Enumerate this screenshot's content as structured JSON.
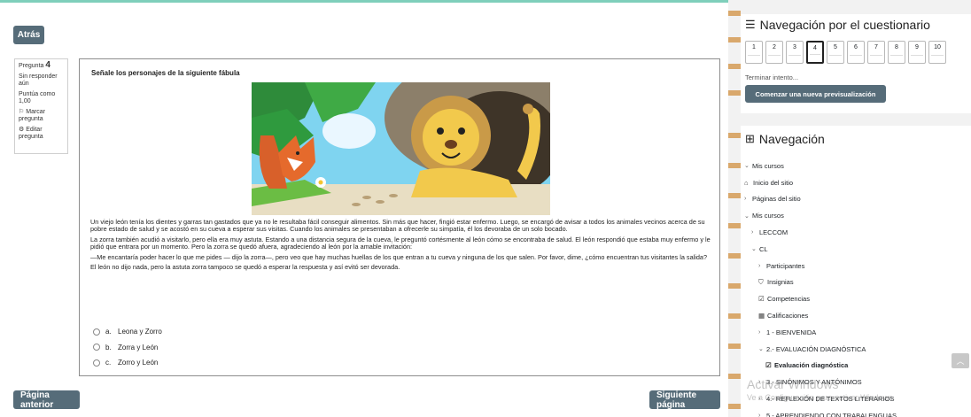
{
  "buttons": {
    "back": "Atrás",
    "prev_page": "Página anterior",
    "next_page": "Siguiente página"
  },
  "question_info": {
    "label": "Pregunta",
    "number": "4",
    "status": "Sin responder aún",
    "points": "Puntúa como 1,00",
    "flag": "Marcar pregunta",
    "edit": "Editar pregunta"
  },
  "question": {
    "title": "Señale los personajes de la siguiente fábula",
    "paragraphs": [
      "Un viejo león tenía los dientes y garras tan gastados que ya no le resultaba fácil conseguir alimentos. Sin más que hacer, fingió estar enfermo. Luego, se encargó de avisar a todos los animales vecinos acerca de su pobre estado de salud y se acostó en su cueva a esperar sus visitas. Cuando los animales se presentaban a ofrecerle su simpatía, él los devoraba de un solo bocado.",
      "La zorra también acudió a visitarlo, pero ella era muy astuta. Estando a una distancia segura de la cueva, le preguntó cortésmente al león cómo se encontraba de salud. El león respondió que estaba muy enfermo y le pidió que entrara por un momento. Pero la zorra se quedó afuera, agradeciendo al león por la amable invitación:",
      "—Me encantaría poder hacer lo que me pides — dijo la zorra—, pero veo que hay muchas huellas de los que entran a tu cueva y ninguna de los que salen. Por favor, dime, ¿cómo encuentran tus visitantes la salida?",
      "El león no dijo nada, pero la astuta zorra tampoco se quedó a esperar la respuesta y así evitó ser devorada."
    ],
    "options": [
      {
        "letter": "a.",
        "text": "Leona y Zorro"
      },
      {
        "letter": "b.",
        "text": "Zorra y León"
      },
      {
        "letter": "c.",
        "text": "Zorro y León"
      }
    ]
  },
  "quiz_nav": {
    "title": "Navegación por el cuestionario",
    "questions": [
      "1",
      "2",
      "3",
      "4",
      "5",
      "6",
      "7",
      "8",
      "9",
      "10"
    ],
    "current": "4",
    "finish_link": "Terminar intento...",
    "new_preview": "Comenzar una nueva previsualización"
  },
  "navigation": {
    "title": "Navegación",
    "items": [
      {
        "label": "Mis cursos",
        "chev": "⌄",
        "icon": ""
      },
      {
        "label": "Inicio del sitio",
        "chev": "",
        "icon": "⌂"
      },
      {
        "label": "Páginas del sitio",
        "chev": "›",
        "icon": ""
      },
      {
        "label": "Mis cursos",
        "chev": "⌄",
        "icon": ""
      },
      {
        "label": "LECCOM",
        "chev": "›",
        "icon": ""
      },
      {
        "label": "CL",
        "chev": "⌄",
        "icon": ""
      },
      {
        "label": "Participantes",
        "chev": "›",
        "icon": ""
      },
      {
        "label": "Insignias",
        "chev": "",
        "icon": "⛉"
      },
      {
        "label": "Competencias",
        "chev": "",
        "icon": "☑"
      },
      {
        "label": "Calificaciones",
        "chev": "",
        "icon": "▦"
      },
      {
        "label": "1 - BIENVENIDA",
        "chev": "›",
        "icon": ""
      },
      {
        "label": "2.- EVALUACIÓN DIAGNÓSTICA",
        "chev": "⌄",
        "icon": ""
      },
      {
        "label": "Evaluación diagnóstica",
        "chev": "",
        "icon": "☑"
      },
      {
        "label": "3.- SINÓNIMOS Y ANTÓNIMOS",
        "chev": "›",
        "icon": ""
      },
      {
        "label": "4.- REFLEXIÓN DE TEXTOS LITERARIOS",
        "chev": "›",
        "icon": ""
      },
      {
        "label": "5.- APRENDIENDO CON TRABALENGUAS",
        "chev": "›",
        "icon": ""
      }
    ]
  },
  "watermark": {
    "line1": "Activar Windows",
    "line2": "Ve a Configuración para activar Windows."
  }
}
